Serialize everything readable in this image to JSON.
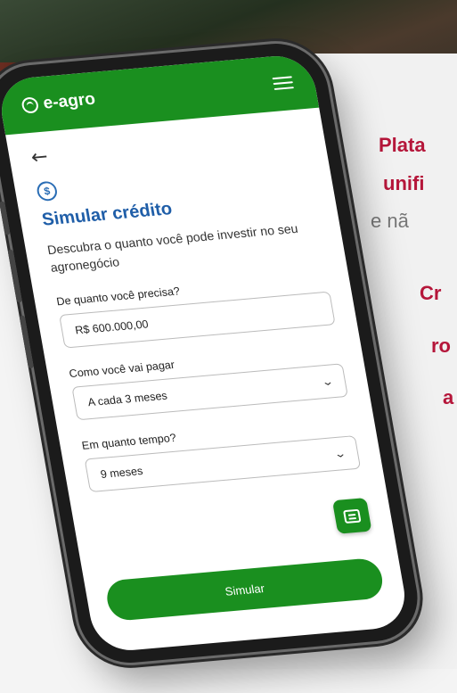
{
  "background": {
    "headline_1": "Plata",
    "headline_2": "unifi",
    "subline": "e nã",
    "line_3": "Cr",
    "line_4": "ro",
    "line_5": "a"
  },
  "app": {
    "brand": "e-agro",
    "back_icon": "arrow-left-icon",
    "page_title": "Simular crédito",
    "description": "Descubra o quanto você pode investir no seu agronegócio",
    "amount_label": "De quanto você precisa?",
    "amount_value": "R$ 600.000,00",
    "payment_label": "Como você vai pagar",
    "payment_value": "A cada 3 meses",
    "term_label": "Em quanto tempo?",
    "term_value": "9 meses",
    "submit_label": "Simular"
  },
  "colors": {
    "brand_green": "#1a8f1f",
    "title_blue": "#1f5ea8",
    "accent_red": "#b5163a"
  }
}
